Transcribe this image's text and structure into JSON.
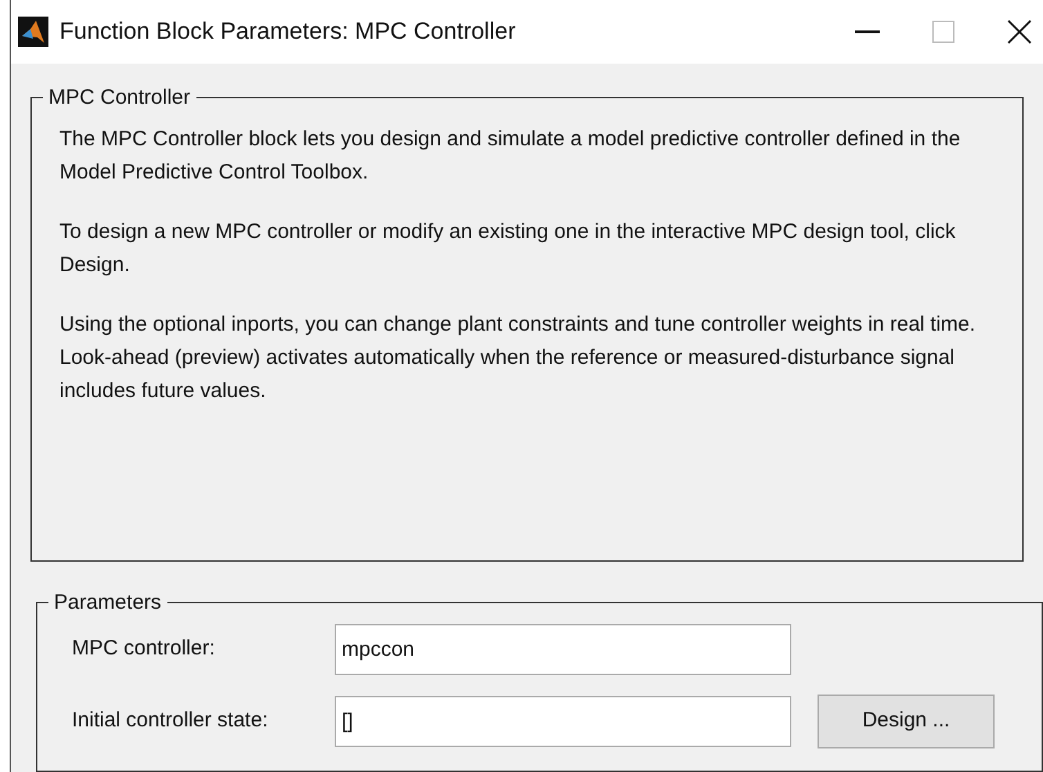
{
  "window": {
    "title": "Function Block Parameters: MPC Controller"
  },
  "description_group": {
    "title": "MPC Controller",
    "paragraphs": [
      "The MPC Controller block lets you design and simulate a model predictive controller defined in the Model Predictive Control Toolbox.",
      "To design a new MPC controller or modify an existing one in the interactive MPC design tool, click Design.",
      "Using the optional inports, you can change plant constraints and tune controller weights in real time.  Look-ahead (preview) activates automatically when the reference or measured-disturbance signal includes future values."
    ]
  },
  "parameters_group": {
    "title": "Parameters",
    "fields": [
      {
        "label": "MPC controller:",
        "value": "mpccon"
      },
      {
        "label": "Initial controller state:",
        "value": "[]",
        "button": "Design ..."
      }
    ]
  }
}
